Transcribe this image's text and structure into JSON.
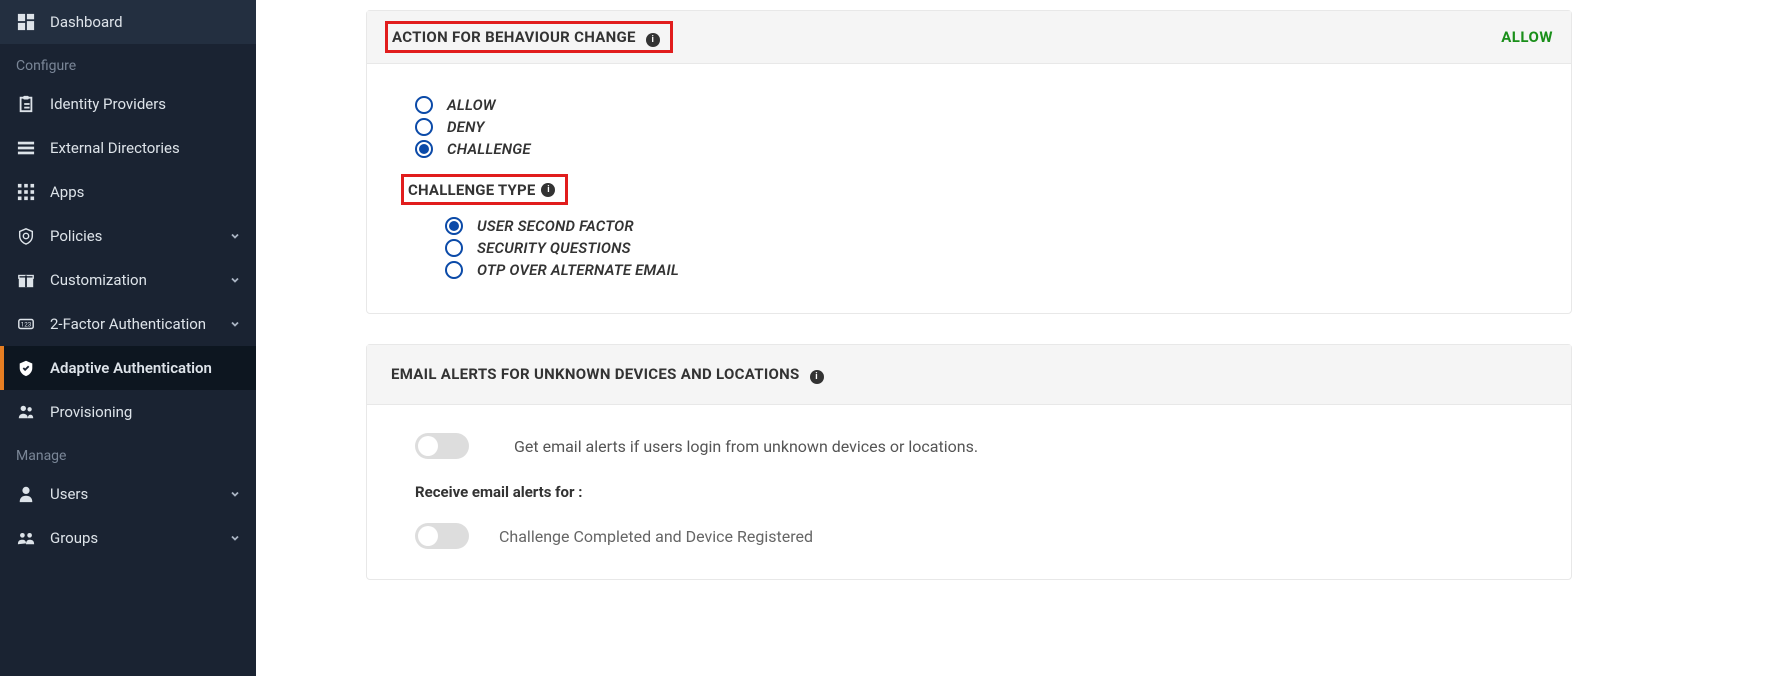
{
  "sidebar": {
    "items": [
      {
        "icon": "dashboard",
        "label": "Dashboard"
      }
    ],
    "section1": "Configure",
    "configure": [
      {
        "icon": "clipboard",
        "label": "Identity Providers"
      },
      {
        "icon": "list",
        "label": "External Directories"
      },
      {
        "icon": "grid",
        "label": "Apps"
      },
      {
        "icon": "shield-q",
        "label": "Policies",
        "chevron": true
      },
      {
        "icon": "gift",
        "label": "Customization",
        "chevron": true
      },
      {
        "icon": "hash",
        "label": "2-Factor Authentication",
        "chevron": true
      },
      {
        "icon": "shield-check",
        "label": "Adaptive Authentication",
        "active": true
      },
      {
        "icon": "people",
        "label": "Provisioning"
      }
    ],
    "section2": "Manage",
    "manage": [
      {
        "icon": "user",
        "label": "Users",
        "chevron": true
      },
      {
        "icon": "group",
        "label": "Groups",
        "chevron": true
      }
    ]
  },
  "card1": {
    "title": "ACTION FOR BEHAVIOUR CHANGE",
    "status": "ALLOW",
    "options": [
      {
        "label": "ALLOW",
        "checked": false
      },
      {
        "label": "DENY",
        "checked": false
      },
      {
        "label": "CHALLENGE",
        "checked": true
      }
    ],
    "challenge_title": "CHALLENGE TYPE",
    "challenge_options": [
      {
        "label": "USER SECOND FACTOR",
        "checked": true
      },
      {
        "label": "SECURITY QUESTIONS",
        "checked": false
      },
      {
        "label": "OTP OVER ALTERNATE EMAIL",
        "checked": false
      }
    ]
  },
  "card2": {
    "title": "EMAIL ALERTS FOR UNKNOWN DEVICES AND LOCATIONS",
    "toggle_desc": "Get email alerts if users login from unknown devices or locations.",
    "receive_label": "Receive email alerts for :",
    "alert_options": [
      {
        "label": "Challenge Completed and Device Registered"
      }
    ]
  }
}
